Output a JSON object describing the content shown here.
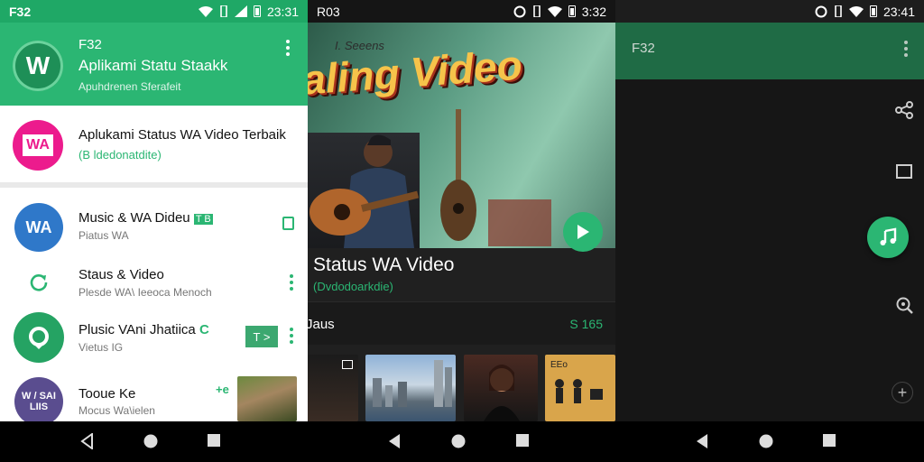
{
  "screen1": {
    "status": {
      "left": "F32",
      "time": "23:31"
    },
    "header": {
      "logo_text": "W",
      "name": "F32",
      "title": "Aplikami Statu Staakk",
      "subtitle": "Apuhdrenen Sferafeit"
    },
    "featured": {
      "logo_text": "WA",
      "title": "Aplukami Status WA Video Terbaik",
      "subtitle": "(B ldedonatdite)"
    },
    "items": [
      {
        "avatar": "WA",
        "title": "Music & WA Dideu",
        "badge": "T B",
        "subtitle": "Piatus WA"
      },
      {
        "avatar": "",
        "title": "Staus & Video",
        "subtitle": "Plesde WA\\ Ieeoca Menoch"
      },
      {
        "avatar": "",
        "title": "Plusic VAni Jhatiica",
        "badge": "C",
        "action": "T >",
        "subtitle": "Vietus IG"
      },
      {
        "avatar": "W / SAILIIS",
        "title": "Tooue Ke",
        "tag": "+e",
        "subtitle": "Mocus Wa\\ielen"
      }
    ]
  },
  "screen2": {
    "status": {
      "left": "R03",
      "time": "3:32"
    },
    "hero": {
      "banner_small": "I. Seeens",
      "banner": "aling Video"
    },
    "title": "Status WA Video",
    "subtitle": "(Dvdodoarkdie)",
    "section": {
      "label": "Jaus",
      "count": "S 165"
    },
    "thumb_label": "EEo"
  },
  "screen3": {
    "status": {
      "time": "23:41"
    },
    "header": {
      "title": "F32"
    }
  },
  "colors": {
    "primary": "#2bb673",
    "primary_dark": "#1f6b45",
    "accent": "#ec1b8d"
  }
}
